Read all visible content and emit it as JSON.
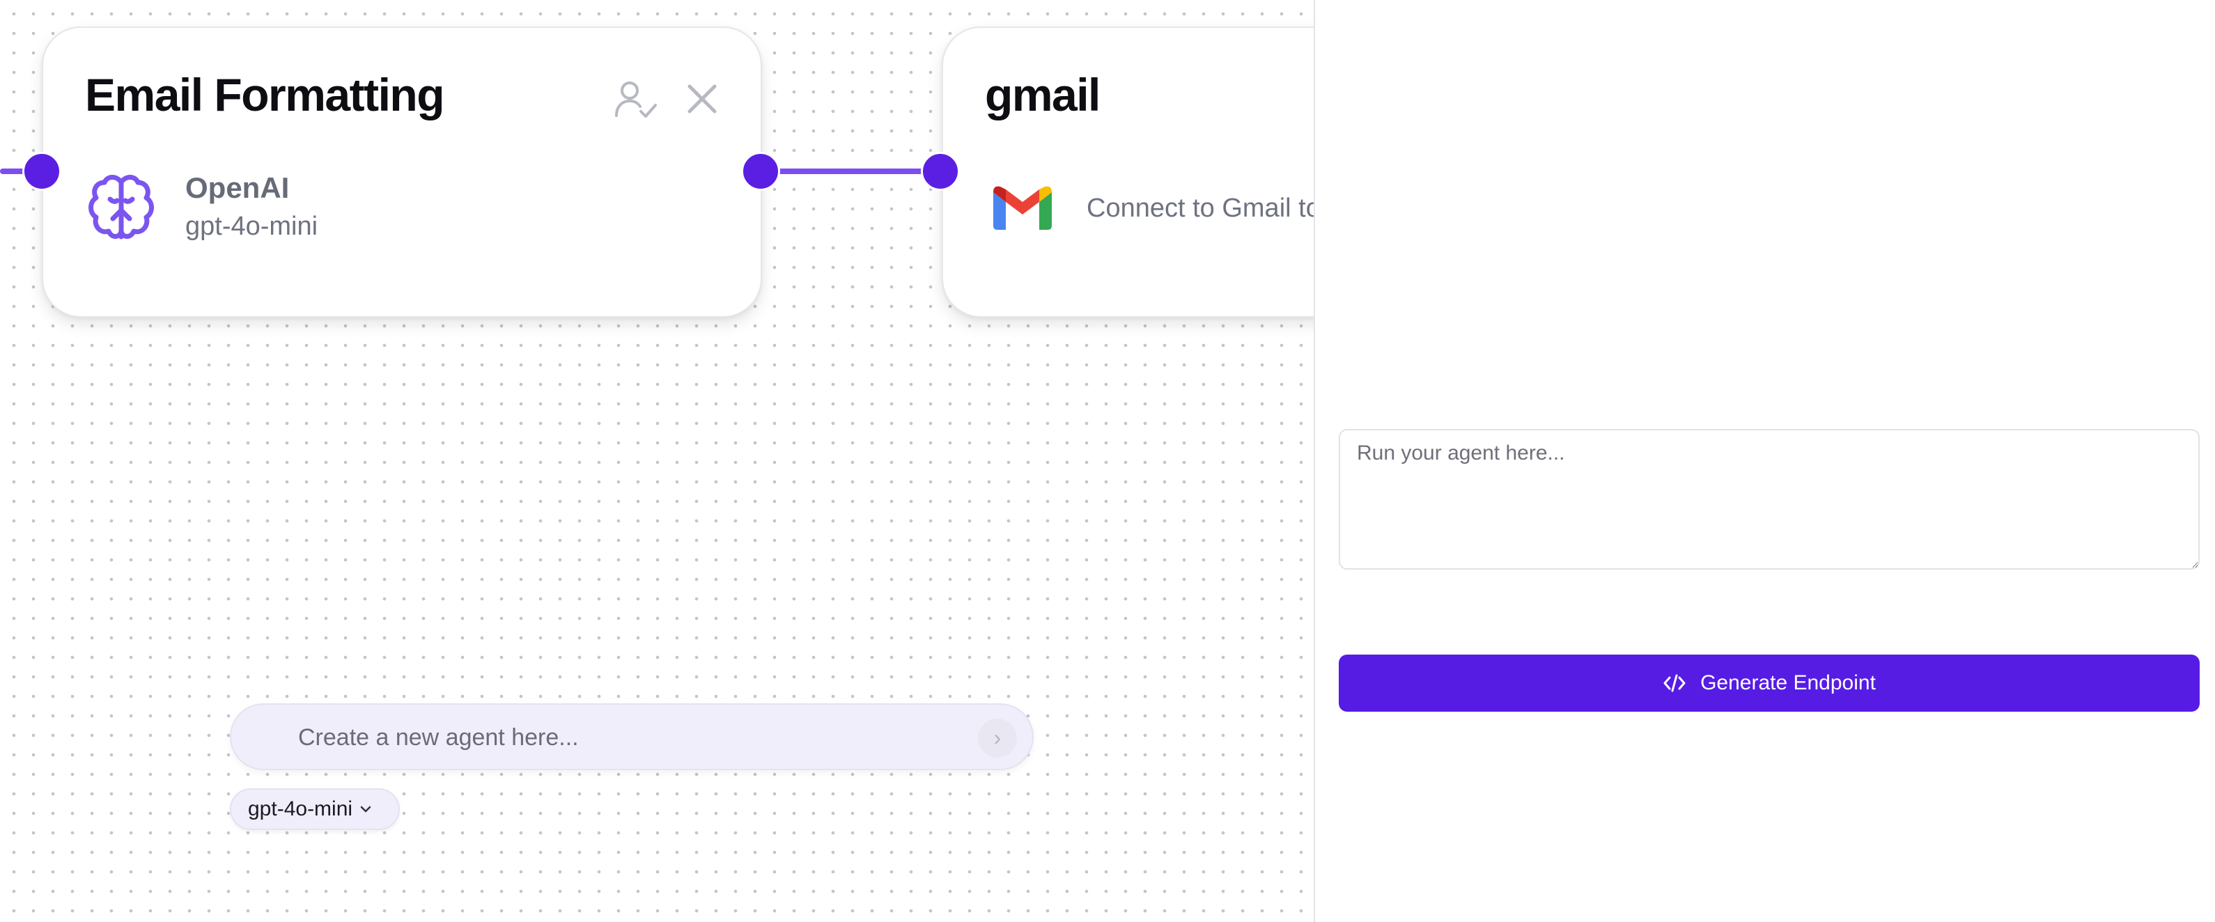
{
  "colors": {
    "accent": "#561ce4",
    "edge": "#7c4df2",
    "canvas_dot": "#c4c4cc"
  },
  "nodes": {
    "email_formatting": {
      "title": "Email Formatting",
      "provider": "OpenAI",
      "model": "gpt-4o-mini",
      "icons": [
        "brain-icon",
        "user-check-icon",
        "close-icon"
      ]
    },
    "gmail": {
      "title": "gmail",
      "description": "Connect to Gmail to",
      "icons": [
        "gmail-icon"
      ]
    }
  },
  "agent_prompt": {
    "placeholder": "Create a new agent here...",
    "model_select": "gpt-4o-mini",
    "icons": [
      "chevron-right-icon",
      "chevron-down-icon"
    ]
  },
  "run_panel": {
    "input_placeholder": "Run your agent here...",
    "generate_button": "Generate Endpoint",
    "icons": [
      "code-icon"
    ]
  }
}
